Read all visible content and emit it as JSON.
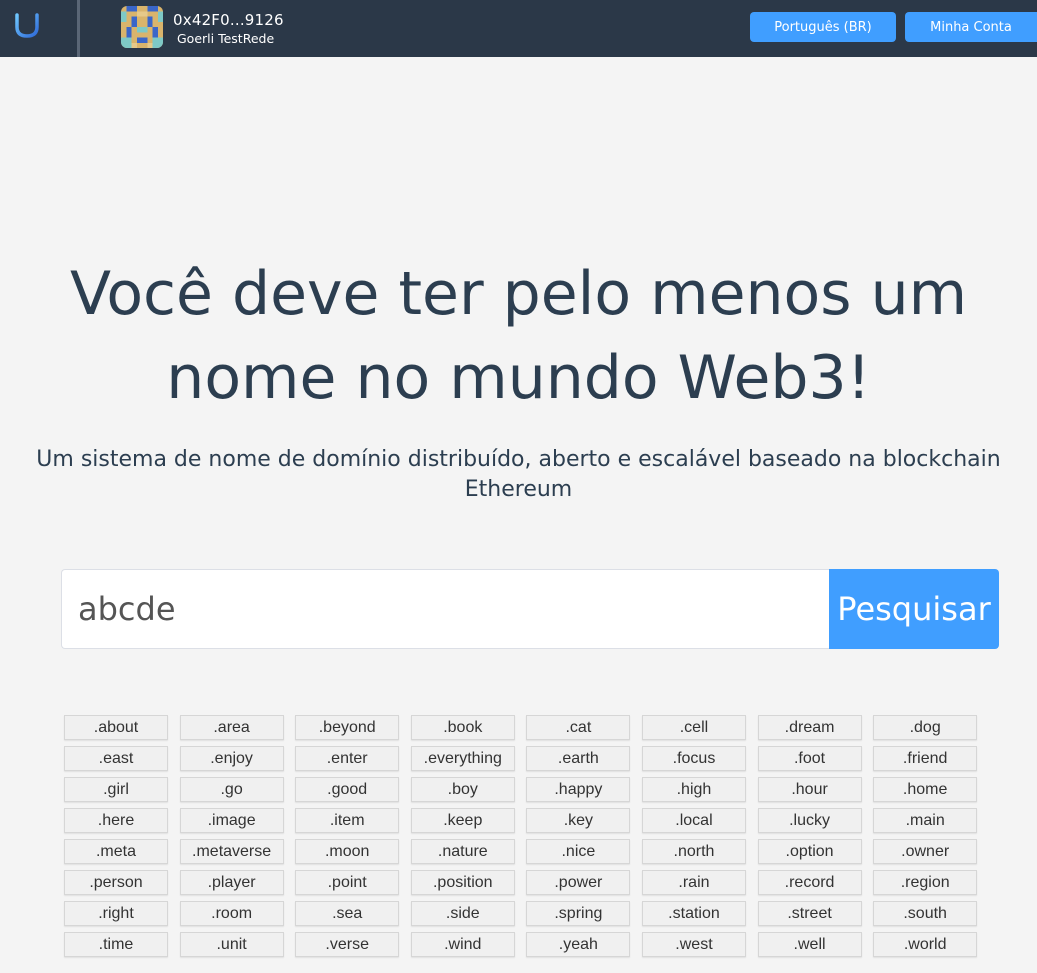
{
  "header": {
    "logo_icon": "u-logo-icon",
    "account_address": "0x42F0...9126",
    "network": "Goerli TestRede",
    "language_label": "Português (BR)",
    "account_label": "Minha Conta",
    "accent_color": "#409eff",
    "bar_color": "#2b3848"
  },
  "hero": {
    "title": "Você deve ter pelo menos um nome no mundo Web3!",
    "subtitle": "Um sistema de nome de domínio distribuído, aberto e escalável baseado na blockchain Ethereum"
  },
  "search": {
    "value": "abcde",
    "button_label": "Pesquisar"
  },
  "tlds": [
    ".about",
    ".area",
    ".beyond",
    ".book",
    ".cat",
    ".cell",
    ".dream",
    ".dog",
    ".east",
    ".enjoy",
    ".enter",
    ".everything",
    ".earth",
    ".focus",
    ".foot",
    ".friend",
    ".girl",
    ".go",
    ".good",
    ".boy",
    ".happy",
    ".high",
    ".hour",
    ".home",
    ".here",
    ".image",
    ".item",
    ".keep",
    ".key",
    ".local",
    ".lucky",
    ".main",
    ".meta",
    ".metaverse",
    ".moon",
    ".nature",
    ".nice",
    ".north",
    ".option",
    ".owner",
    ".person",
    ".player",
    ".point",
    ".position",
    ".power",
    ".rain",
    ".record",
    ".region",
    ".right",
    ".room",
    ".sea",
    ".side",
    ".spring",
    ".station",
    ".street",
    ".south",
    ".time",
    ".unit",
    ".verse",
    ".wind",
    ".yeah",
    ".west",
    ".well",
    ".world"
  ]
}
